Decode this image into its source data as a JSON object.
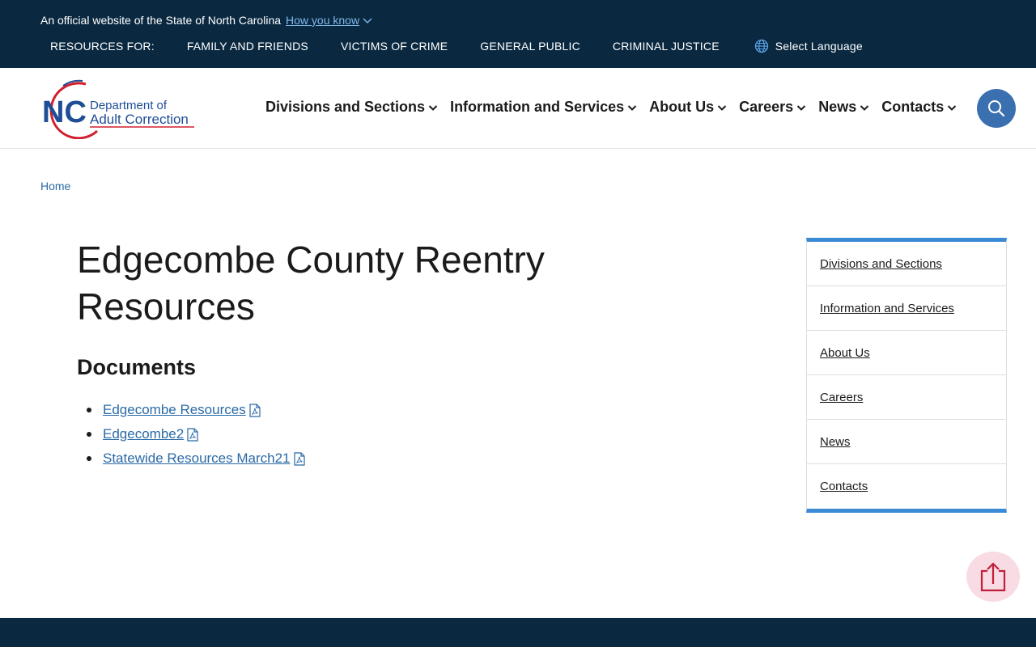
{
  "banner": {
    "official_text": "An official website of the State of North Carolina",
    "how_you_know": "How you know"
  },
  "resources_bar": {
    "label": "RESOURCES FOR:",
    "links": [
      "FAMILY AND FRIENDS",
      "VICTIMS OF CRIME",
      "GENERAL PUBLIC",
      "CRIMINAL JUSTICE"
    ],
    "language": "Select Language"
  },
  "logo": {
    "initials": "NC",
    "line1": "Department of",
    "line2": "Adult Correction"
  },
  "nav": {
    "items": [
      "Divisions and Sections",
      "Information and Services",
      "About Us",
      "Careers",
      "News",
      "Contacts"
    ]
  },
  "breadcrumb": {
    "home": "Home"
  },
  "main": {
    "title": "Edgecombe County Reentry Resources",
    "documents_heading": "Documents",
    "documents": [
      "Edgecombe Resources",
      "Edgecombe2",
      "Statewide Resources March21"
    ]
  },
  "sidebar": {
    "items": [
      "Divisions and Sections",
      "Information and Services",
      "About Us",
      "Careers",
      "News",
      "Contacts"
    ]
  },
  "colors": {
    "banner_bg": "#0a2941",
    "link": "#2a6aa6",
    "accent_blue": "#3a8ad6",
    "search_bg": "#3a70b0",
    "logo_red": "#d0202e",
    "logo_blue": "#1f4e96"
  },
  "icons": {
    "how_you_know": "chevron-down-icon",
    "language": "globe-icon",
    "nav": "chevron-down-icon",
    "search": "search-icon",
    "documents": "pdf-file-icon",
    "back_to_top": "arrow-up-icon"
  }
}
